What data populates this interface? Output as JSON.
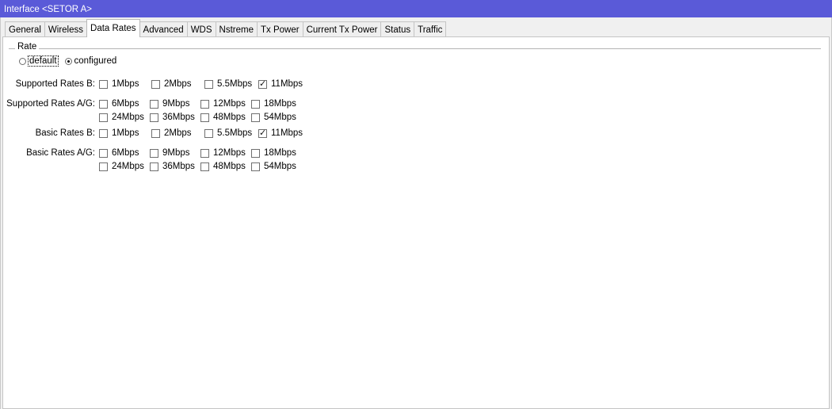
{
  "window": {
    "title": "Interface <SETOR A>"
  },
  "tabs": [
    {
      "label": "General",
      "active": false
    },
    {
      "label": "Wireless",
      "active": false
    },
    {
      "label": "Data Rates",
      "active": true
    },
    {
      "label": "Advanced",
      "active": false
    },
    {
      "label": "WDS",
      "active": false
    },
    {
      "label": "Nstreme",
      "active": false
    },
    {
      "label": "Tx Power",
      "active": false
    },
    {
      "label": "Current Tx Power",
      "active": false
    },
    {
      "label": "Status",
      "active": false
    },
    {
      "label": "Traffic",
      "active": false
    }
  ],
  "rate": {
    "group_title": "Rate",
    "options": [
      {
        "label": "default",
        "selected": false
      },
      {
        "label": "configured",
        "selected": true
      }
    ]
  },
  "supported_b": {
    "label": "Supported Rates B:",
    "rates": [
      {
        "label": "1Mbps",
        "checked": false
      },
      {
        "label": "2Mbps",
        "checked": false
      },
      {
        "label": "5.5Mbps",
        "checked": false
      },
      {
        "label": "11Mbps",
        "checked": true
      }
    ]
  },
  "supported_ag": {
    "label": "Supported Rates A/G:",
    "rates": [
      {
        "label": "6Mbps",
        "checked": false
      },
      {
        "label": "9Mbps",
        "checked": false
      },
      {
        "label": "12Mbps",
        "checked": false
      },
      {
        "label": "18Mbps",
        "checked": false
      },
      {
        "label": "24Mbps",
        "checked": false
      },
      {
        "label": "36Mbps",
        "checked": false
      },
      {
        "label": "48Mbps",
        "checked": false
      },
      {
        "label": "54Mbps",
        "checked": false
      }
    ]
  },
  "basic_b": {
    "label": "Basic Rates B:",
    "rates": [
      {
        "label": "1Mbps",
        "checked": false
      },
      {
        "label": "2Mbps",
        "checked": false
      },
      {
        "label": "5.5Mbps",
        "checked": false
      },
      {
        "label": "11Mbps",
        "checked": true
      }
    ]
  },
  "basic_ag": {
    "label": "Basic Rates A/G:",
    "rates": [
      {
        "label": "6Mbps",
        "checked": false
      },
      {
        "label": "9Mbps",
        "checked": false
      },
      {
        "label": "12Mbps",
        "checked": false
      },
      {
        "label": "18Mbps",
        "checked": false
      },
      {
        "label": "24Mbps",
        "checked": false
      },
      {
        "label": "36Mbps",
        "checked": false
      },
      {
        "label": "48Mbps",
        "checked": false
      },
      {
        "label": "54Mbps",
        "checked": false
      }
    ]
  },
  "colors": {
    "titlebar": "#5a5ad8",
    "panel": "#ffffff",
    "chrome": "#f0f0f0"
  }
}
